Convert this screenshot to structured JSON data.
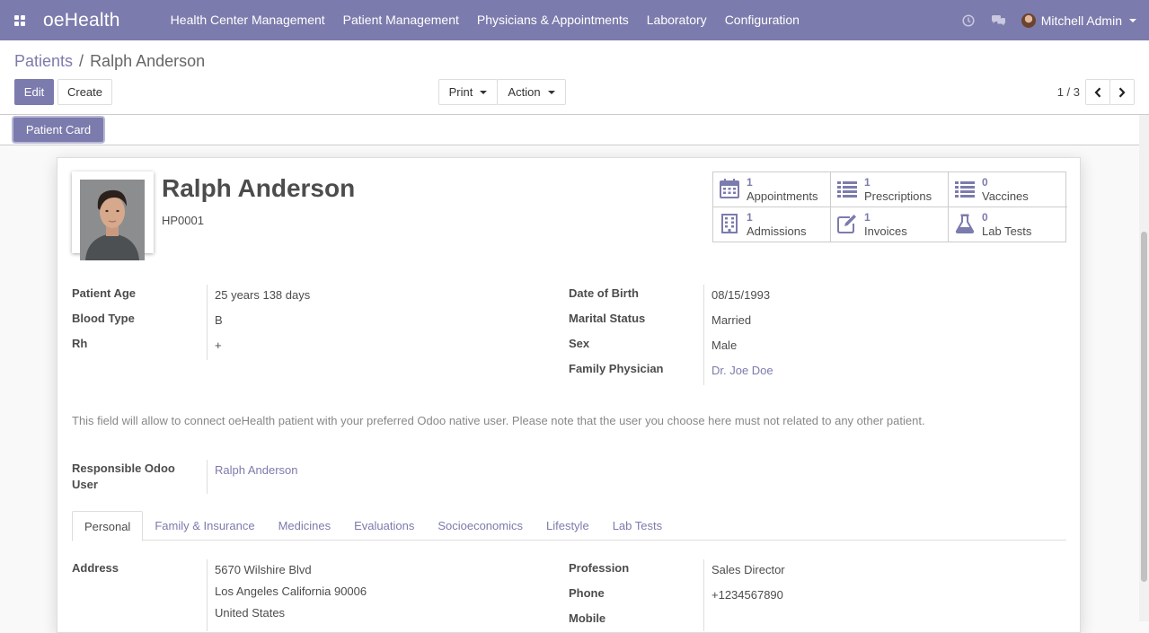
{
  "navbar": {
    "brand": "oeHealth",
    "menu": [
      "Health Center Management",
      "Patient Management",
      "Physicians & Appointments",
      "Laboratory",
      "Configuration"
    ],
    "user": "Mitchell Admin"
  },
  "control_panel": {
    "breadcrumb_parent": "Patients",
    "breadcrumb_sep": "/",
    "breadcrumb_current": "Ralph Anderson",
    "edit": "Edit",
    "create": "Create",
    "print": "Print",
    "action": "Action",
    "pager": "1 / 3"
  },
  "statusbar": {
    "button": "Patient Card"
  },
  "patient": {
    "name": "Ralph Anderson",
    "code": "HP0001"
  },
  "stats": [
    {
      "count": "1",
      "label": "Appointments",
      "icon": "calendar-icon"
    },
    {
      "count": "1",
      "label": "Prescriptions",
      "icon": "list-icon"
    },
    {
      "count": "0",
      "label": "Vaccines",
      "icon": "list-icon"
    },
    {
      "count": "1",
      "label": "Admissions",
      "icon": "building-icon"
    },
    {
      "count": "1",
      "label": "Invoices",
      "icon": "edit-icon"
    },
    {
      "count": "0",
      "label": "Lab Tests",
      "icon": "flask-icon"
    }
  ],
  "fields_left": [
    {
      "label": "Patient Age",
      "value": "25 years 138 days"
    },
    {
      "label": "Blood Type",
      "value": "B"
    },
    {
      "label": "Rh",
      "value": "+"
    }
  ],
  "fields_right": [
    {
      "label": "Date of Birth",
      "value": "08/15/1993"
    },
    {
      "label": "Marital Status",
      "value": "Married"
    },
    {
      "label": "Sex",
      "value": "Male"
    },
    {
      "label": "Family Physician",
      "value": "Dr. Joe Doe"
    }
  ],
  "help_text": "This field will allow to connect oeHealth patient with your preferred Odoo native user. Please note that the user you choose here must not related to any other patient.",
  "responsible": {
    "label_line1": "Responsible Odoo",
    "label_line2": "User",
    "value": "Ralph Anderson"
  },
  "tabs": [
    "Personal",
    "Family & Insurance",
    "Medicines",
    "Evaluations",
    "Socioeconomics",
    "Lifestyle",
    "Lab Tests"
  ],
  "personal": {
    "address_label": "Address",
    "address_lines": [
      "5670 Wilshire Blvd",
      "Los Angeles  California  90006",
      "United States"
    ],
    "profession_label": "Profession",
    "profession": "Sales Director",
    "phone_label": "Phone",
    "phone": "+1234567890",
    "mobile_label": "Mobile"
  },
  "colors": {
    "brand": "#7c7bad",
    "text": "#4c4c4c"
  }
}
